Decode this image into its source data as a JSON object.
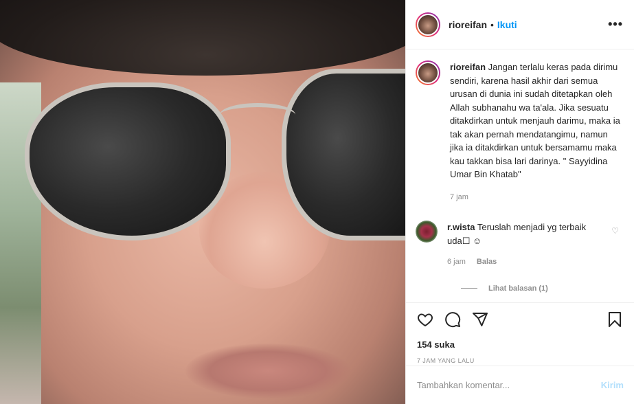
{
  "header": {
    "username": "rioreifan",
    "separator": "•",
    "follow_label": "Ikuti",
    "more_icon": "more-horizontal-icon",
    "more_glyph": "•••"
  },
  "caption": {
    "username": "rioreifan",
    "text": "Jangan terlalu keras pada dirimu sendiri, karena hasil akhir dari semua urusan di dunia ini sudah ditetapkan oleh Allah subhanahu wa ta'ala. Jika sesuatu ditakdirkan untuk menjauh darimu, maka ia tak akan pernah mendatangimu, namun jika ia ditakdirkan untuk bersamamu maka kau takkan bisa lari darinya. \" Sayyidina Umar Bin Khatab\"",
    "time": "7 jam"
  },
  "comment": {
    "username": "r.wista",
    "text": "Teruslah menjadi yg terbaik uda☐ ☺",
    "time": "6 jam",
    "reply_label": "Balas",
    "like_icon": "heart-outline-icon",
    "heart_glyph": "♡",
    "view_replies": "Lihat balasan (1)"
  },
  "actions": {
    "like_icon": "heart-icon",
    "comment_icon": "comment-icon",
    "share_icon": "paper-plane-icon",
    "save_icon": "bookmark-icon"
  },
  "likes": "154 suka",
  "posted": "7 JAM YANG LALU",
  "add_comment": {
    "placeholder": "Tambahkan komentar...",
    "post_label": "Kirim"
  },
  "colors": {
    "accent": "#0095f6",
    "post_disabled": "#b2dffc",
    "muted": "#8e8e8e",
    "text": "#262626"
  }
}
